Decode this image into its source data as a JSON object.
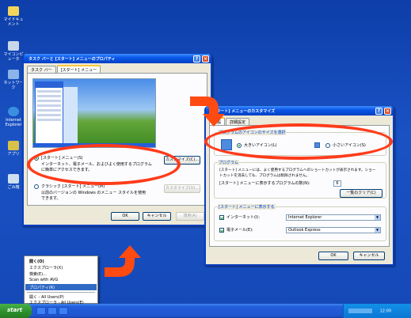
{
  "desktop_icons": [
    {
      "name": "desktop-icon-documents",
      "label": "マイドキュメント",
      "color": "#f2d55a"
    },
    {
      "name": "desktop-icon-computer",
      "label": "マイコンピュータ",
      "color": "#c9d7ea"
    },
    {
      "name": "desktop-icon-network",
      "label": "ネットワーク",
      "color": "#8ab4ea"
    },
    {
      "name": "desktop-icon-ie",
      "label": "Internet Explorer",
      "color": "#3b8fe0"
    },
    {
      "name": "desktop-icon-app",
      "label": "アプリ",
      "color": "#d9c04a"
    },
    {
      "name": "desktop-icon-recycle",
      "label": "ごみ箱",
      "color": "#cfe0f0"
    }
  ],
  "dialog1": {
    "title": "タスク バーと [スタート] メニューのプロパティ",
    "tabs": [
      "タスク バー",
      "[スタート] メニュー"
    ],
    "start_menu_label": "[スタート] メニュー(S)",
    "start_menu_desc1": "インターネット、電子メール、およびよく使用するプログラム",
    "start_menu_desc2": "に簡単にアクセスできます。",
    "customize1": "カスタマイズ(C)...",
    "classic_label": "クラシック [スタート] メニュー(M)",
    "classic_desc1": "以前のバージョンの Windows のメニュー スタイルを使用",
    "classic_desc2": "できます。",
    "customize2": "カスタマイズ(U)...",
    "ok": "OK",
    "cancel": "キャンセル",
    "apply": "適用(A)"
  },
  "dialog2": {
    "title": "[スタート] メニューのカスタマイズ",
    "tabs": [
      "全般",
      "詳細設定"
    ],
    "icon_group": "プログラムのアイコンのサイズを選択",
    "large_icons": "大きいアイコン(L)",
    "small_icons": "小さいアイコン(S)",
    "programs_group": "プログラム",
    "programs_desc1": "[スタート] メニューには、よく使用するプログラムへのショートカットが表示されます。ショー",
    "programs_desc2": "トカットを消去しても、プログラムは削除されません。",
    "programs_count_label": "[スタート] メニューに表示するプログラムの数(N):",
    "programs_count": "6",
    "clear_list": "一覧のクリア(C)",
    "show_group": "[スタート] メニューに表示する",
    "internet_label": "インターネット(I):",
    "internet_value": "Internet Explorer",
    "email_label": "電子メール(E):",
    "email_value": "Outlook Express",
    "ok": "OK",
    "cancel": "キャンセル"
  },
  "context_menu": {
    "items": [
      "開く(O)",
      "エクスプローラ(X)",
      "検索(E)...",
      "Scan with AVG",
      "プロパティ(R)",
      "開く - All Users(P)",
      "エクスプローラ - All Users(E)"
    ]
  },
  "taskbar": {
    "start": "start",
    "tray_text": "12:00"
  },
  "colors": {
    "highlight_ellipse": "#ff3b1a",
    "arrow": "#ff4a12"
  }
}
